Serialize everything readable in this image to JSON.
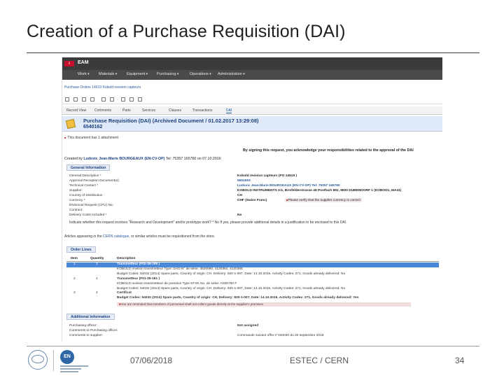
{
  "slide": {
    "title": "Creation of a Purchase Requisition (DAI)",
    "footer_date": "07/06/2018",
    "footer_org": "ESTEC / CERN",
    "page_number": "34"
  },
  "app": {
    "name": "EAM",
    "menu": [
      "Work",
      "Materials",
      "Equipment",
      "Purchasing",
      "Operations",
      "Administration"
    ],
    "breadcrumb": "Purchase Orders 14519 Kobold revision capteurs",
    "tabs": [
      "Record View",
      "Comments",
      "Parts",
      "Services",
      "Clauses",
      "Transactions",
      "DAI"
    ],
    "active_tab": "DAI"
  },
  "header": {
    "title": "Purchase Requisition (DAI) (Archived Document / 01.02.2017 13:29:08)",
    "number": "6540162"
  },
  "attachment_note": "This document has 1 attachment",
  "sign_note": "By signing this request, you acknowledge your responsibilities related to the approval of the DAI",
  "created_by": {
    "prefix": "Created by",
    "name": "Ludovic Jean-Marie BOURGEAUX (EN-CV-OP)",
    "details": "Tel: 75357 165760 on 07.10.2016"
  },
  "general_info": {
    "heading": "General Information",
    "rows": [
      {
        "label": "General Description *",
        "value": "Kobold revision capteurs (PO 14519 )"
      },
      {
        "label": "Approval Reception Document(s):",
        "value": "6551553"
      },
      {
        "label": "Technical Contact *",
        "value": "Ludovic Jean-Marie BOURGEAUX (EN-CV-OP) Tel: 75357 165760"
      },
      {
        "label": "Supplier:",
        "value": "KOBOLD INSTRUMENTS AG, Birsfelderstrasse 48 Postfach 892, 8600 DUBENDORF 1 (KOBOD1, MA41)"
      },
      {
        "label": "Country of Distribution :",
        "value": "CH"
      },
      {
        "label": "Currency *",
        "value": "CHF (Swiss Franc)"
      },
      {
        "label": "Divisional Request (CFU) No:",
        "value": ""
      },
      {
        "label": "Contract:",
        "value": ""
      },
      {
        "label": "Delivery Costs included *",
        "value": "No"
      }
    ],
    "currency_warning": "Please verify that the supplier currency is correct",
    "rd_note": "Indicate whether this request involves \"Research and Development\" and/or prototype work? * No If yes, please provide additional details in a justification to be enclosed to this DAI"
  },
  "articles_note": {
    "before": "Articles appearing in the",
    "link": "CERN catalogue",
    "after": ", or similar articles must be requisitioned from the store."
  },
  "order_lines": {
    "heading": "Order Lines",
    "columns": [
      "Item",
      "Quantity",
      "Description"
    ],
    "items": [
      {
        "item": "1",
        "quantity": "3",
        "selected": true,
        "lines": [
          "Transmetteur (F02-39-199 )",
          "KOBOLD revision transmetteur Type: DAD N° de série: 4520590, 4120364, 4120365",
          "Budget Codes: 54032 (2014) Spare parts, Country of origin: CH, Delivery: 820-1-007, Date: 14.10.2016, Activity Codes: 271, Goods already delivered: No"
        ]
      },
      {
        "item": "2",
        "quantity": "1",
        "selected": false,
        "lines": [
          "Transmetteur (F01-39-181 )",
          "KOBOLD revision transmetteur de pression Type KFXK No. de série: AS00760 F",
          "Budget Codes: 54032 (2014) Spare parts, Country of origin: CH, Delivery: 820-1-007, Date: 14.10.2016, Activity Codes: 271, Goods already delivered: No"
        ]
      },
      {
        "item": "3",
        "quantity": "4",
        "selected": false,
        "lines": [
          "Certificat",
          "Budget Codes: 54032 (2014) Spare parts, Country of origin: CH, Delivery: 820-1-007, Date: 14.10.2016, Activity Codes: 271, Goods already delivered: Yes"
        ]
      }
    ],
    "info_note": "You are reminded that members of personnel shall not collect goods directly at the supplier's premises"
  },
  "additional_info": {
    "heading": "Additional Information",
    "rows": [
      {
        "label": "Purchasing officer:",
        "value": "Not assigned"
      },
      {
        "label": "Comments to Purchasing officer:",
        "value": ""
      },
      {
        "label": "Comments to supplier:",
        "value": "Commande suivant offre n°234030 du 20 septembre 2016"
      }
    ]
  },
  "colors": {
    "app_bar": "#3b3b3b",
    "header_band": "#dfe9f7",
    "selected_row": "#4a86d9",
    "heading_text": "#1c3f80"
  }
}
